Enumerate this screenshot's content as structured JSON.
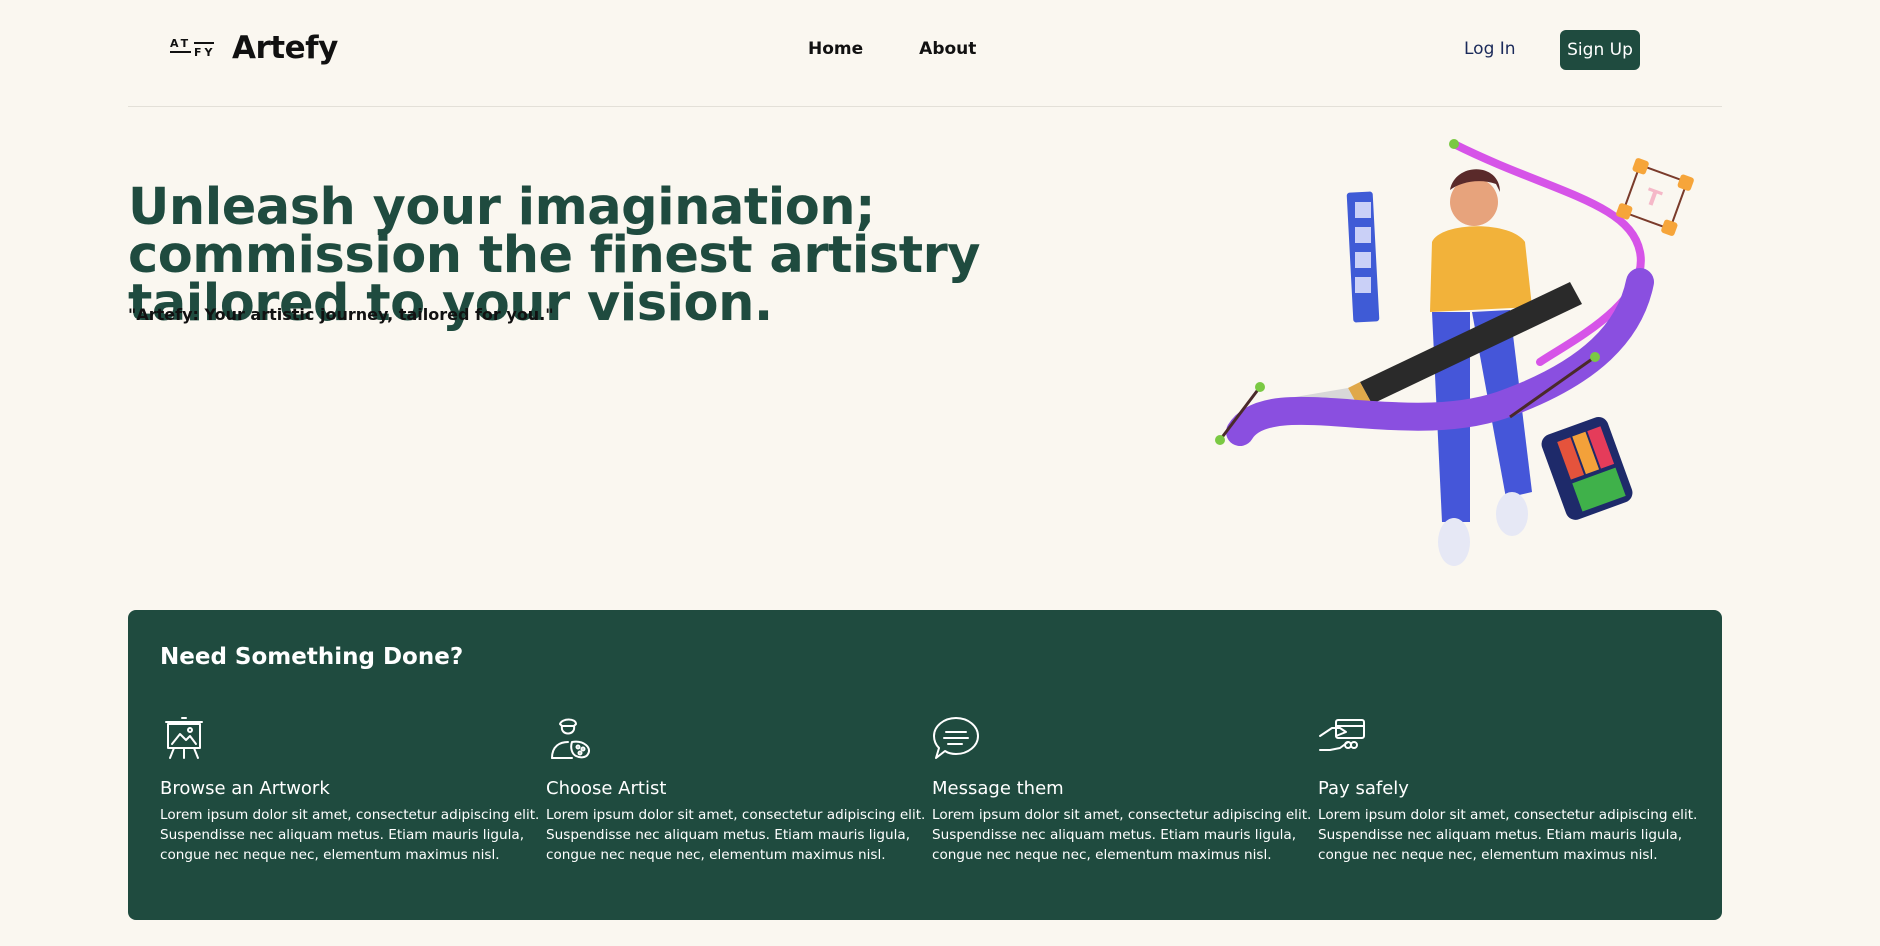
{
  "brand": {
    "mark_top": "AT",
    "mark_bottom": "FY",
    "name": "Artefy"
  },
  "nav": {
    "items": [
      "Home",
      "About"
    ]
  },
  "auth": {
    "login": "Log In",
    "signup": "Sign Up"
  },
  "hero": {
    "title": "Unleash your imagination; commission the finest artistry tailored to your vision.",
    "tagline": "\"Artefy: Your artistic journey, tailored for you.\""
  },
  "steps": {
    "heading": "Need Something Done?",
    "items": [
      {
        "icon": "easel-icon",
        "title": "Browse an Artwork",
        "text": "Lorem ipsum dolor sit amet, consectetur adipiscing elit. Suspendisse nec aliquam metus. Etiam mauris ligula, congue nec neque nec, elementum maximus nisl."
      },
      {
        "icon": "artist-icon",
        "title": "Choose Artist",
        "text": "Lorem ipsum dolor sit amet, consectetur adipiscing elit. Suspendisse nec aliquam metus. Etiam mauris ligula, congue nec neque nec, elementum maximus nisl."
      },
      {
        "icon": "chat-bubble-icon",
        "title": "Message them",
        "text": "Lorem ipsum dolor sit amet, consectetur adipiscing elit. Suspendisse nec aliquam metus. Etiam mauris ligula, congue nec neque nec, elementum maximus nisl."
      },
      {
        "icon": "card-payment-icon",
        "title": "Pay safely",
        "text": "Lorem ipsum dolor sit amet, consectetur adipiscing elit. Suspendisse nec aliquam metus. Etiam mauris ligula, congue nec neque nec, elementum maximus nisl."
      }
    ]
  },
  "colors": {
    "primary": "#1f4b3f",
    "background": "#faf7f0"
  }
}
